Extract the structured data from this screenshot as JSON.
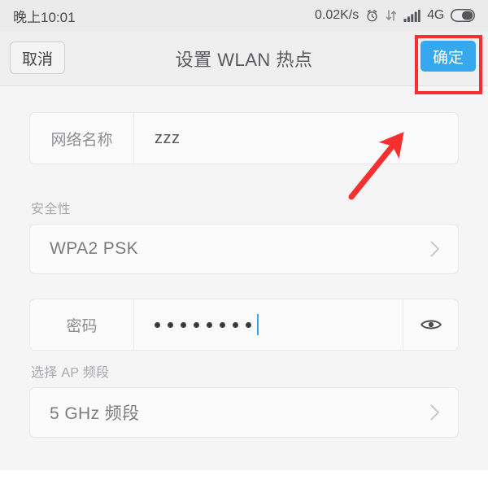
{
  "statusbar": {
    "time": "晚上10:01",
    "network_speed": "0.02K/s",
    "network_type": "4G",
    "icons": [
      "alarm-icon",
      "sync-icon",
      "signal-icon",
      "battery-icon"
    ]
  },
  "navbar": {
    "cancel_label": "取消",
    "title": "设置 WLAN 热点",
    "ok_label": "确定"
  },
  "annotations": {
    "highlight_color": "#f82f2f",
    "arrow_color": "#f82f2f",
    "highlight_target": "确定"
  },
  "form": {
    "network_name": {
      "label": "网络名称",
      "value": "zzz"
    },
    "security": {
      "section_label": "安全性",
      "value": "WPA2 PSK",
      "chevron": "chevron-right-icon"
    },
    "password": {
      "label": "密码",
      "masked_value": "••••••••",
      "dot_count": 8,
      "reveal_icon": "eye-icon"
    },
    "ap_band": {
      "section_label": "选择 AP 频段",
      "value": "5 GHz 频段",
      "chevron": "chevron-right-icon"
    }
  },
  "colors": {
    "accent": "#36a9ee",
    "page_bg": "#f5f5f6",
    "card_bg": "#fbfbfb",
    "caret": "#3aa6e8"
  }
}
